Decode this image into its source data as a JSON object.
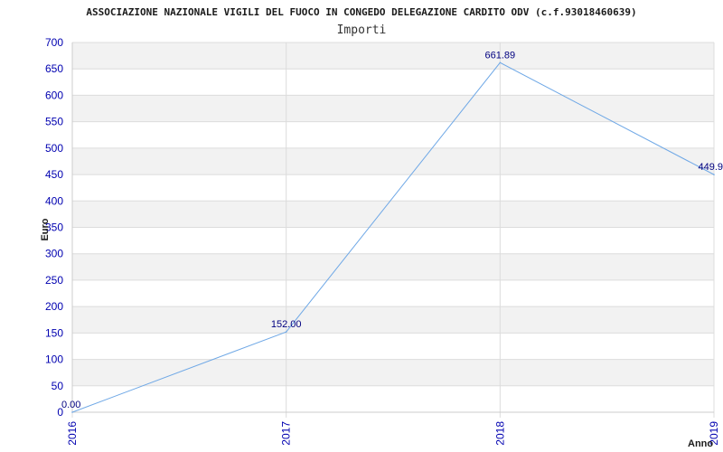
{
  "header": {
    "title": "ASSOCIAZIONE NAZIONALE VIGILI DEL FUOCO IN CONGEDO DELEGAZIONE CARDITO ODV (c.f.93018460639)",
    "subtitle": "Importi"
  },
  "chart_data": {
    "type": "line",
    "title": "ASSOCIAZIONE NAZIONALE VIGILI DEL FUOCO IN CONGEDO DELEGAZIONE CARDITO ODV (c.f.93018460639)",
    "subtitle": "Importi",
    "xlabel": "Anno",
    "ylabel": "Euro",
    "categories": [
      "2016",
      "2017",
      "2018",
      "2019"
    ],
    "values": [
      0,
      152,
      661.89,
      449.9
    ],
    "value_labels": [
      "0.00",
      "152.00",
      "661.89",
      "449.9"
    ],
    "ylim": [
      0,
      700
    ],
    "yticks": [
      0,
      50,
      100,
      150,
      200,
      250,
      300,
      350,
      400,
      450,
      500,
      550,
      600,
      650,
      700
    ],
    "grid": true,
    "banded_background": true,
    "colors": {
      "line": "#6fa8e6",
      "band": "#f2f2f2",
      "grid": "#dcdcdc",
      "tick_text": "#0000b0",
      "label_text": "#000080"
    }
  }
}
